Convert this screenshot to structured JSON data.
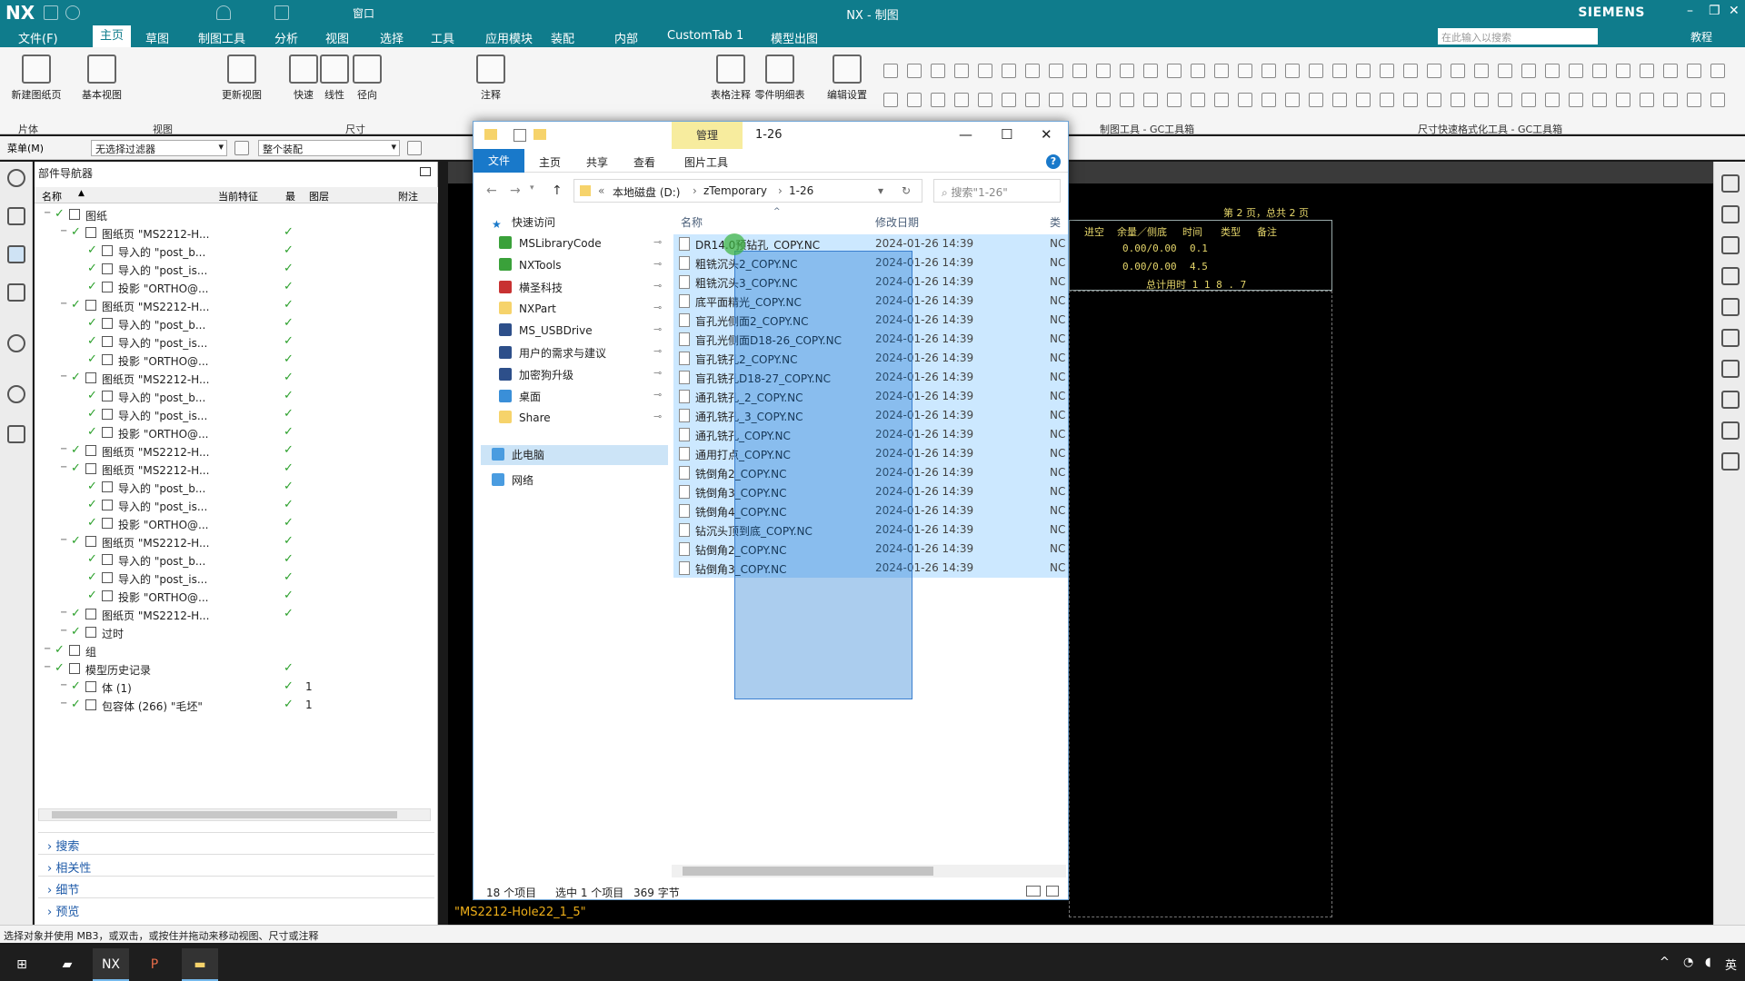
{
  "nx": {
    "title": "NX - 制图",
    "logo": "NX",
    "brand": "SIEMENS",
    "menu": [
      "文件(F)",
      "主页",
      "草图",
      "制图工具",
      "分析",
      "视图",
      "选择",
      "工具",
      "应用模块",
      "装配",
      "内部",
      "CustomTab 1",
      "模型出图"
    ],
    "search_placeholder": "在此输入以搜索",
    "tutorial": "教程",
    "window_label": "窗口",
    "ribbon_buttons": [
      "新建图纸页",
      "基本视图",
      "更新视图",
      "快速",
      "线性",
      "径向",
      "注释",
      "表格注释",
      "零件明细表",
      "编辑设置"
    ],
    "ribbon_groups": [
      "片体",
      "视图",
      "尺寸",
      "制图工具 - GC工具箱",
      "尺寸快速格式化工具 - GC工具箱"
    ],
    "filter": {
      "menu": "菜单(M)",
      "filter_value": "无选择过滤器",
      "scope_value": "整个装配"
    },
    "status_bar": "选择对象并使用 MB3，或双击，或按住并拖动来移动视图、尺寸或注释",
    "canvas_sheet_label": "\"MS2212-Hole22_1_5\"",
    "cad": {
      "page_info": "第 2 页，总共 2 页",
      "headers": [
        "进空",
        "余量／侧底",
        "时间",
        "类型",
        "备注"
      ],
      "rows": [
        [
          "0.00/0.00",
          "0.1"
        ],
        [
          "0.00/0.00",
          "4.5"
        ]
      ],
      "total": "总计用时    1 1 8 . 7"
    }
  },
  "navigator": {
    "title": "部件导航器",
    "headers": [
      "名称",
      "当前特征",
      "最",
      "图层",
      "附注"
    ],
    "rows": [
      {
        "indent": 0,
        "label": "图纸",
        "check": "",
        "layer": ""
      },
      {
        "indent": 1,
        "label": "图纸页 \"MS2212-H...",
        "check": "✓",
        "layer": ""
      },
      {
        "indent": 2,
        "label": "导入的 \"post_b...",
        "check": "✓",
        "layer": ""
      },
      {
        "indent": 2,
        "label": "导入的 \"post_is...",
        "check": "✓",
        "layer": ""
      },
      {
        "indent": 2,
        "label": "投影 \"ORTHO@...",
        "check": "✓",
        "layer": ""
      },
      {
        "indent": 1,
        "label": "图纸页 \"MS2212-H...",
        "check": "✓",
        "layer": ""
      },
      {
        "indent": 2,
        "label": "导入的 \"post_b...",
        "check": "✓",
        "layer": ""
      },
      {
        "indent": 2,
        "label": "导入的 \"post_is...",
        "check": "✓",
        "layer": ""
      },
      {
        "indent": 2,
        "label": "投影 \"ORTHO@...",
        "check": "✓",
        "layer": ""
      },
      {
        "indent": 1,
        "label": "图纸页 \"MS2212-H...",
        "check": "✓",
        "layer": ""
      },
      {
        "indent": 2,
        "label": "导入的 \"post_b...",
        "check": "✓",
        "layer": ""
      },
      {
        "indent": 2,
        "label": "导入的 \"post_is...",
        "check": "✓",
        "layer": ""
      },
      {
        "indent": 2,
        "label": "投影 \"ORTHO@...",
        "check": "✓",
        "layer": ""
      },
      {
        "indent": 1,
        "label": "图纸页 \"MS2212-H...",
        "check": "✓",
        "layer": ""
      },
      {
        "indent": 1,
        "label": "图纸页 \"MS2212-H...",
        "check": "✓",
        "layer": ""
      },
      {
        "indent": 2,
        "label": "导入的 \"post_b...",
        "check": "✓",
        "layer": ""
      },
      {
        "indent": 2,
        "label": "导入的 \"post_is...",
        "check": "✓",
        "layer": ""
      },
      {
        "indent": 2,
        "label": "投影 \"ORTHO@...",
        "check": "✓",
        "layer": ""
      },
      {
        "indent": 1,
        "label": "图纸页 \"MS2212-H...",
        "check": "✓",
        "layer": ""
      },
      {
        "indent": 2,
        "label": "导入的 \"post_b...",
        "check": "✓",
        "layer": ""
      },
      {
        "indent": 2,
        "label": "导入的 \"post_is...",
        "check": "✓",
        "layer": ""
      },
      {
        "indent": 2,
        "label": "投影 \"ORTHO@...",
        "check": "✓",
        "layer": ""
      },
      {
        "indent": 1,
        "label": "图纸页 \"MS2212-H...",
        "check": "✓",
        "layer": ""
      },
      {
        "indent": 1,
        "label": "过时",
        "check": "",
        "layer": ""
      },
      {
        "indent": 0,
        "label": "组",
        "check": "",
        "layer": ""
      },
      {
        "indent": 0,
        "label": "模型历史记录",
        "check": "✓",
        "layer": ""
      },
      {
        "indent": 1,
        "label": "体 (1)",
        "check": "✓",
        "layer": "1"
      },
      {
        "indent": 1,
        "label": "包容体 (266) \"毛坯\"",
        "check": "✓",
        "layer": "1"
      }
    ],
    "accordion": [
      "搜索",
      "相关性",
      "细节",
      "预览"
    ]
  },
  "explorer": {
    "manage_tab": "管理",
    "path_title": "1-26",
    "tabs": [
      "文件",
      "主页",
      "共享",
      "查看",
      "图片工具"
    ],
    "breadcrumb": [
      "«",
      "本地磁盘 (D:)",
      "zTemporary",
      "1-26"
    ],
    "search_placeholder": "搜索\"1-26\"",
    "sidebar": {
      "quick_access": "快速访问",
      "items": [
        "MSLibraryCode",
        "NXTools",
        "横圣科技",
        "NXPart",
        "MS_USBDrive",
        "用户的需求与建议",
        "加密狗升级",
        "桌面",
        "Share"
      ],
      "this_pc": "此电脑",
      "network": "网络"
    },
    "columns": [
      "名称",
      "修改日期",
      "类"
    ],
    "files": [
      {
        "name": "DR14.0预钻孔_COPY.NC",
        "date": "2024-01-26 14:39",
        "type": "NC"
      },
      {
        "name": "粗铣沉头2_COPY.NC",
        "date": "2024-01-26 14:39",
        "type": "NC"
      },
      {
        "name": "粗铣沉头3_COPY.NC",
        "date": "2024-01-26 14:39",
        "type": "NC"
      },
      {
        "name": "底平面精光_COPY.NC",
        "date": "2024-01-26 14:39",
        "type": "NC"
      },
      {
        "name": "盲孔光侧面2_COPY.NC",
        "date": "2024-01-26 14:39",
        "type": "NC"
      },
      {
        "name": "盲孔光侧面D18-26_COPY.NC",
        "date": "2024-01-26 14:39",
        "type": "NC"
      },
      {
        "name": "盲孔铣孔2_COPY.NC",
        "date": "2024-01-26 14:39",
        "type": "NC"
      },
      {
        "name": "盲孔铣孔D18-27_COPY.NC",
        "date": "2024-01-26 14:39",
        "type": "NC"
      },
      {
        "name": "通孔铣孔_2_COPY.NC",
        "date": "2024-01-26 14:39",
        "type": "NC"
      },
      {
        "name": "通孔铣孔_3_COPY.NC",
        "date": "2024-01-26 14:39",
        "type": "NC"
      },
      {
        "name": "通孔铣孔_COPY.NC",
        "date": "2024-01-26 14:39",
        "type": "NC"
      },
      {
        "name": "通用打点_COPY.NC",
        "date": "2024-01-26 14:39",
        "type": "NC"
      },
      {
        "name": "铣倒角2_COPY.NC",
        "date": "2024-01-26 14:39",
        "type": "NC"
      },
      {
        "name": "铣倒角3_COPY.NC",
        "date": "2024-01-26 14:39",
        "type": "NC"
      },
      {
        "name": "铣倒角4_COPY.NC",
        "date": "2024-01-26 14:39",
        "type": "NC"
      },
      {
        "name": "钻沉头顶到底_COPY.NC",
        "date": "2024-01-26 14:39",
        "type": "NC"
      },
      {
        "name": "钻倒角2_COPY.NC",
        "date": "2024-01-26 14:39",
        "type": "NC"
      },
      {
        "name": "钻倒角3_COPY.NC",
        "date": "2024-01-26 14:39",
        "type": "NC"
      }
    ],
    "status": {
      "count": "18 个项目",
      "selected": "选中 1 个项目",
      "size": "369 字节"
    }
  },
  "taskbar": {
    "tray": "英"
  }
}
